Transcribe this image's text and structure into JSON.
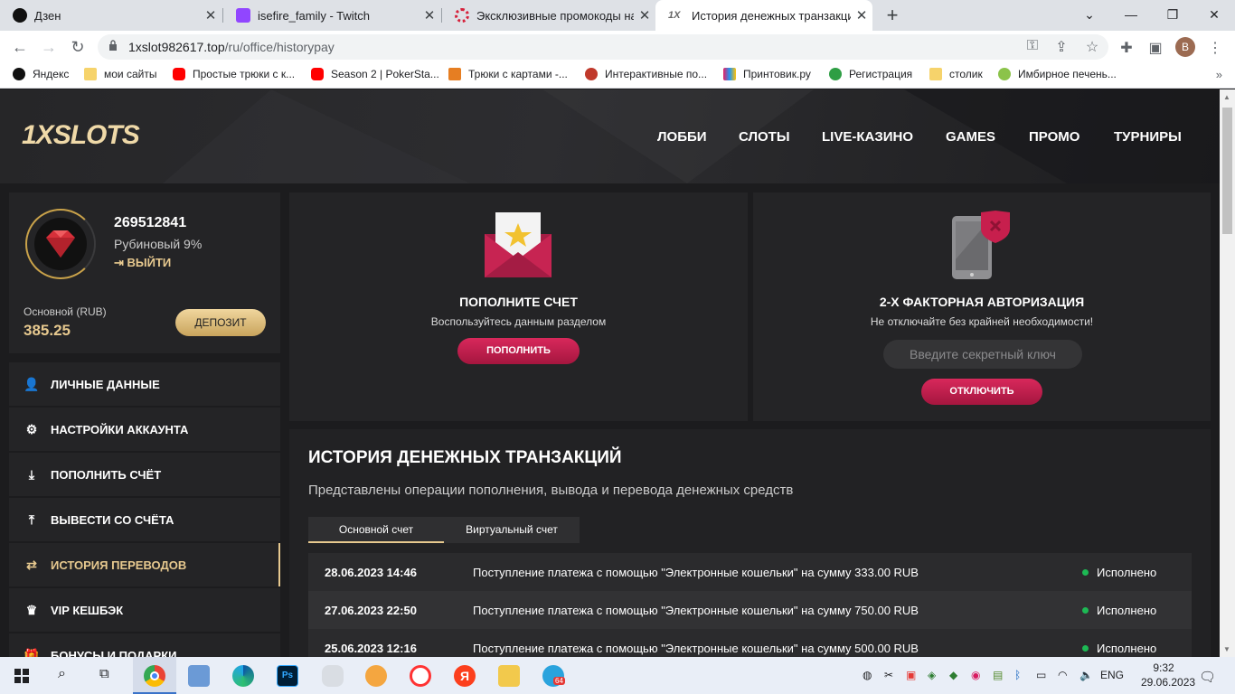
{
  "browser": {
    "tabs": [
      {
        "title": "Дзен",
        "icon": "zen-icon"
      },
      {
        "title": "isefire_family - Twitch",
        "icon": "twitch-icon"
      },
      {
        "title": "Эксклюзивные промокоды на ф",
        "icon": "promo-site-icon"
      },
      {
        "title": "История денежных транзакций",
        "icon": "1x-icon",
        "active": true
      }
    ],
    "url_host": "1xslot982617.top",
    "url_path": "/ru/office/historypay",
    "profile_initial": "B",
    "bookmarks": [
      "Яндекс",
      "мои сайты",
      "Простые трюки с к...",
      "Season 2 | PokerSta...",
      "Трюки с картами -...",
      "Интерактивные по...",
      "Принтовик.ру",
      "Регистрация",
      "столик",
      "Имбирное печень..."
    ]
  },
  "site": {
    "logo_1x": "1X",
    "logo_slots": "SLOTS",
    "menu": [
      "ЛОББИ",
      "СЛОТЫ",
      "LIVE-КАЗИНО",
      "GAMES",
      "ПРОМО",
      "ТУРНИРЫ"
    ],
    "profile": {
      "user_id": "269512841",
      "rank": "Рубиновый 9%",
      "logout": "ВЫЙТИ",
      "balance_label": "Основной (RUB)",
      "balance": "385.25",
      "deposit_button": "ДЕПОЗИТ"
    },
    "sidebar": [
      {
        "label": "ЛИЧНЫЕ ДАННЫЕ",
        "icon": "user-add-icon"
      },
      {
        "label": "НАСТРОЙКИ АККАУНТА",
        "icon": "gears-icon"
      },
      {
        "label": "ПОПОЛНИТЬ СЧЁТ",
        "icon": "download-icon"
      },
      {
        "label": "ВЫВЕСТИ СО СЧЁТА",
        "icon": "upload-icon"
      },
      {
        "label": "ИСТОРИЯ ПЕРЕВОДОВ",
        "icon": "transfer-arrows-icon",
        "active": true
      },
      {
        "label": "VIP КЕШБЭК",
        "icon": "crown-icon"
      },
      {
        "label": "БОНУСЫ И ПОДАРКИ",
        "icon": "gift-icon"
      }
    ],
    "deposit_card": {
      "title": "ПОПОЛНИТЕ СЧЕТ",
      "subtitle": "Воспользуйтесь данным разделом",
      "button": "ПОПОЛНИТЬ"
    },
    "twofa_card": {
      "title": "2-Х ФАКТОРНАЯ АВТОРИЗАЦИЯ",
      "subtitle": "Не отключайте без крайней необходимости!",
      "placeholder": "Введите секретный ключ",
      "button": "ОТКЛЮЧИТЬ"
    },
    "history": {
      "title": "ИСТОРИЯ ДЕНЕЖНЫХ ТРАНЗАКЦИЙ",
      "description": "Представлены операции пополнения, вывода и перевода денежных средств",
      "tabs": [
        "Основной счет",
        "Виртуальный счет"
      ],
      "rows": [
        {
          "date": "28.06.2023 14:46",
          "message": "Поступление платежа с помощью \"Электронные кошельки\" на сумму 333.00 RUB",
          "status": "Исполнено"
        },
        {
          "date": "27.06.2023 22:50",
          "message": "Поступление платежа с помощью \"Электронные кошельки\" на сумму 750.00 RUB",
          "status": "Исполнено"
        },
        {
          "date": "25.06.2023 12:16",
          "message": "Поступление платежа с помощью \"Электронные кошельки\" на сумму 500.00 RUB",
          "status": "Исполнено"
        }
      ]
    }
  },
  "taskbar": {
    "lang": "ENG",
    "time": "9:32",
    "date": "29.06.2023",
    "telegram_badge": "64"
  }
}
